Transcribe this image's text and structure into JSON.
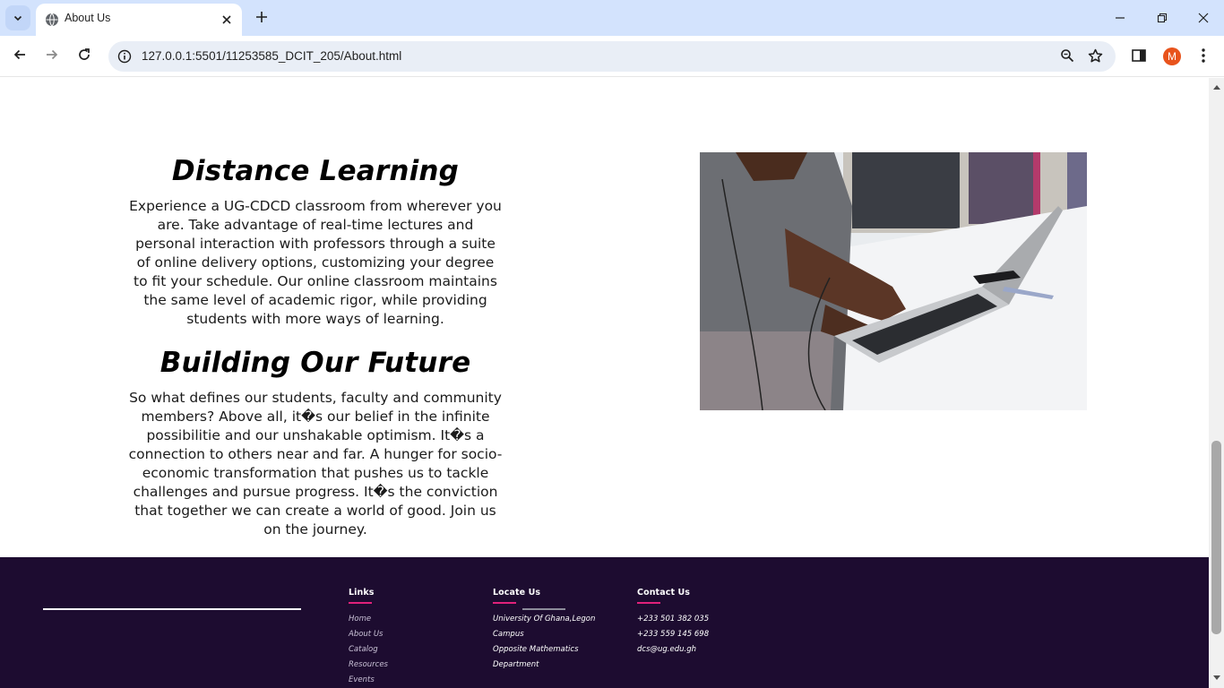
{
  "browser": {
    "tab_title": "About Us",
    "url": "127.0.0.1:5501/11253585_DCIT_205/About.html",
    "profile_initial": "M",
    "accent": "#d3e3fd",
    "avatar_color": "#e8531c"
  },
  "content": {
    "sections": [
      {
        "heading": "Distance Learning",
        "body": "Experience a UG-CDCD classroom from wherever you are. Take advantage of real-time lectures and personal interaction with professors through a suite of online delivery options, customizing your degree to fit your schedule. Our online classroom maintains the same level of academic rigor, while providing students with more ways of learning."
      },
      {
        "heading": "Building Our Future",
        "body": "So what defines our students, faculty and community members? Above all, it�s our belief in the infinite possibilitie and our unshakable optimism. It�s a connection to others near and far. A hunger for socio-economic transformation that pushes us to tackle challenges and pursue progress. It�s the conviction that together we can create a world of good. Join us on the journey."
      }
    ],
    "photo_icon": "laptop-typing-photo"
  },
  "footer": {
    "background": "#1d0c30",
    "accent": "#e0217a",
    "links": {
      "title": "Links",
      "items": [
        "Home",
        "About Us",
        "Catalog",
        "Resources",
        "Events"
      ]
    },
    "locate": {
      "title": "Locate Us",
      "items": [
        "University Of Ghana,Legon",
        "Campus",
        "Opposite Mathematics",
        "Department"
      ]
    },
    "contact": {
      "title": "Contact Us",
      "items": [
        "+233 501 382 035",
        "+233 559 145 698",
        "dcs@ug.edu.gh"
      ]
    }
  }
}
